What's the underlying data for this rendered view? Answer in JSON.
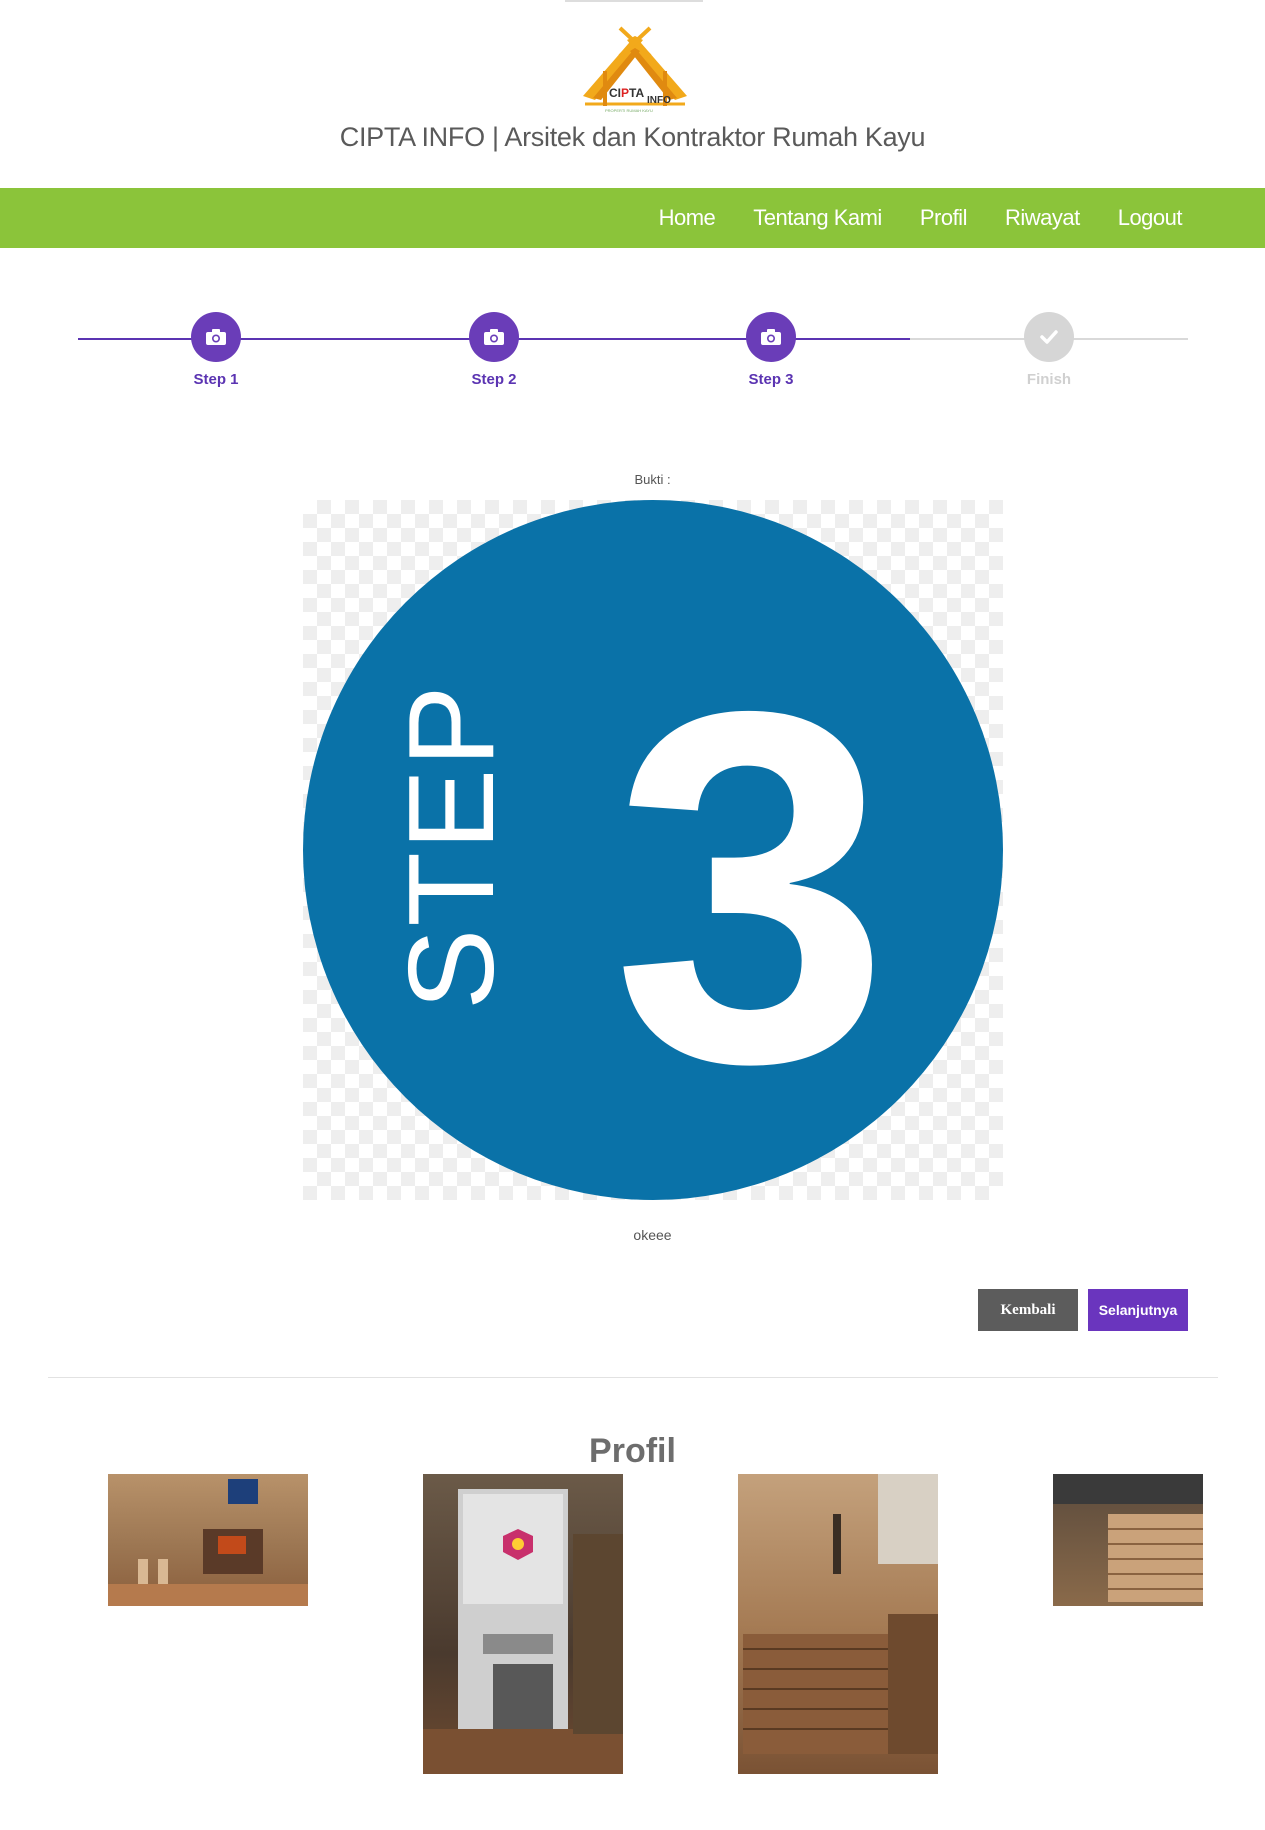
{
  "header": {
    "logo_alt": "CIPTA INFO logo",
    "logo_text_left": "CI",
    "logo_text_p": "P",
    "logo_text_ta": "TA",
    "logo_text_info": "INFO",
    "logo_tagline": "PROPERTI RUMAH KAYU",
    "site_title": "CIPTA INFO | Arsitek dan Kontraktor Rumah Kayu"
  },
  "nav": {
    "items": [
      {
        "label": "Home"
      },
      {
        "label": "Tentang Kami"
      },
      {
        "label": "Profil"
      },
      {
        "label": "Riwayat"
      },
      {
        "label": "Logout"
      }
    ]
  },
  "wizard": {
    "steps": [
      {
        "label": "Step 1",
        "state": "active",
        "icon": "camera-icon"
      },
      {
        "label": "Step 2",
        "state": "active",
        "icon": "camera-icon"
      },
      {
        "label": "Step 3",
        "state": "active",
        "icon": "camera-icon"
      },
      {
        "label": "Finish",
        "state": "inactive",
        "icon": "check-icon"
      }
    ],
    "colors": {
      "active": "#6a3db8",
      "inactive": "#d6d6d6"
    }
  },
  "proof": {
    "label": "Bukti :",
    "image_word": "STEP",
    "image_number": "3",
    "circle_color": "#0a72a8",
    "caption": "okeee"
  },
  "buttons": {
    "back_label": "Kembali",
    "next_label": "Selanjutnya"
  },
  "profile": {
    "heading": "Profil"
  },
  "colors": {
    "nav_bg": "#8bc43a",
    "accent": "#6a35be"
  }
}
